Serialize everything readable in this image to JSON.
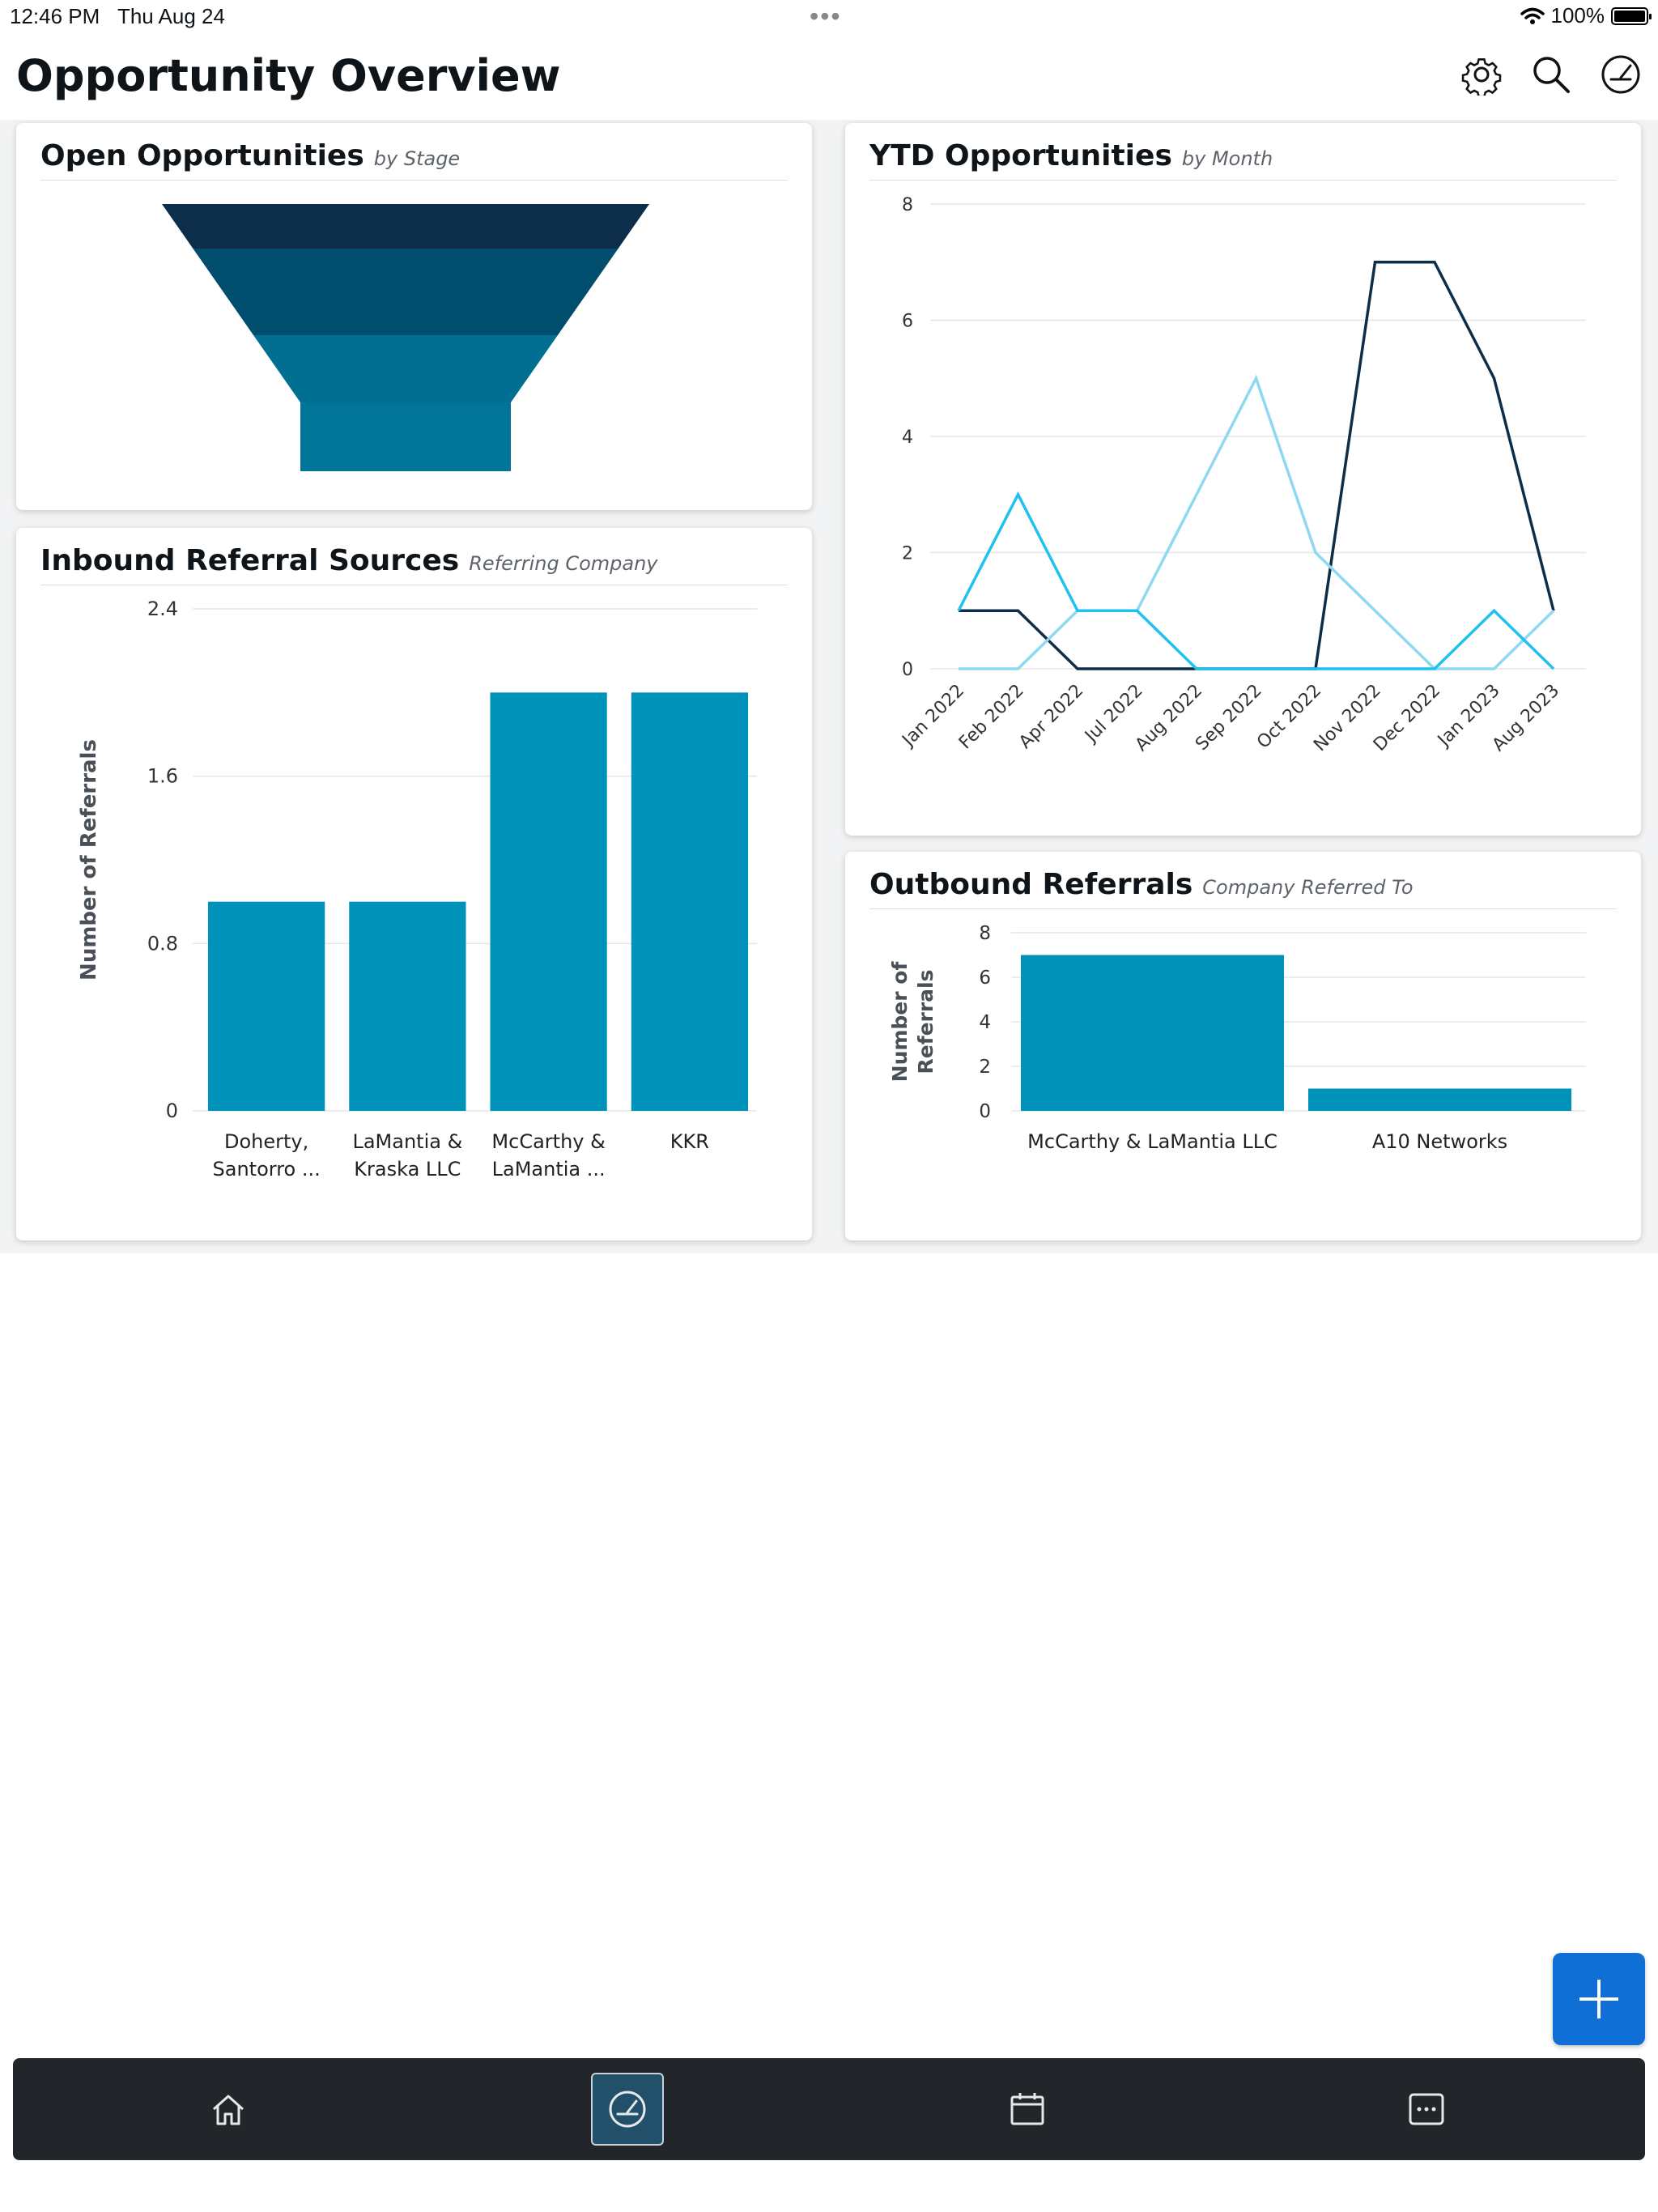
{
  "status": {
    "time": "12:46 PM",
    "date": "Thu Aug 24",
    "battery": "100%"
  },
  "header": {
    "title": "Opportunity Overview"
  },
  "icons": {
    "settings": "gear-icon",
    "search": "search-icon",
    "dashboard": "gauge-icon"
  },
  "colors": {
    "dark_navy": "#0d2e4a",
    "mid_teal": "#00678d",
    "bar_teal": "#0092b8",
    "light_blue": "#8fd8f2",
    "cyan": "#1fc1ee",
    "fab_blue": "#0f6fd6",
    "tabbar": "#22262b"
  },
  "cards": {
    "open": {
      "title": "Open Opportunities",
      "sub": "by Stage"
    },
    "ytd": {
      "title": "YTD Opportunities",
      "sub": "by Month"
    },
    "inbound": {
      "title": "Inbound Referral Sources",
      "sub": "Referring Company"
    },
    "outbound": {
      "title": "Outbound Referrals",
      "sub": "Company Referred To"
    }
  },
  "chart_data": [
    {
      "type": "funnel",
      "stages": [
        {
          "color": "#0d2e4a"
        },
        {
          "color": "#004d6e"
        },
        {
          "color": "#006f92"
        },
        {
          "color": "#007599"
        }
      ]
    },
    {
      "type": "line",
      "x": [
        "Jan 2022",
        "Feb 2022",
        "Apr 2022",
        "Jul 2022",
        "Aug 2022",
        "Sep 2022",
        "Oct 2022",
        "Nov 2022",
        "Dec 2022",
        "Jan 2023",
        "Aug 2023"
      ],
      "ylim": [
        0,
        8
      ],
      "yticks": [
        "0",
        "2",
        "4",
        "6",
        "8"
      ],
      "series": [
        {
          "color": "#0d2e4a",
          "values": [
            1,
            1,
            0,
            0,
            0,
            0,
            0,
            7,
            7,
            5,
            1
          ]
        },
        {
          "color": "#8fd8f2",
          "values": [
            0,
            0,
            1,
            1,
            3,
            5,
            2,
            1,
            0,
            0,
            1
          ]
        },
        {
          "color": "#1fc1ee",
          "values": [
            1,
            3,
            1,
            1,
            0,
            0,
            0,
            0,
            0,
            1,
            0
          ]
        }
      ]
    },
    {
      "type": "bar",
      "ylabel": "Number of Referrals",
      "ylim": [
        0,
        2.4
      ],
      "yticks": [
        "0",
        "0.8",
        "1.6",
        "2.4"
      ],
      "categories": [
        [
          "Doherty,",
          "Santorro ..."
        ],
        [
          "LaMantia &",
          "Kraska LLC"
        ],
        [
          "McCarthy &",
          "LaMantia ..."
        ],
        [
          "KKR"
        ]
      ],
      "values": [
        1,
        1,
        2,
        2
      ]
    },
    {
      "type": "bar",
      "ylabel": [
        "Number of",
        "Referrals"
      ],
      "ylim": [
        0,
        8
      ],
      "yticks": [
        "0",
        "2",
        "4",
        "6",
        "8"
      ],
      "categories": [
        "McCarthy & LaMantia LLC",
        "A10 Networks"
      ],
      "values": [
        7,
        1
      ]
    }
  ]
}
